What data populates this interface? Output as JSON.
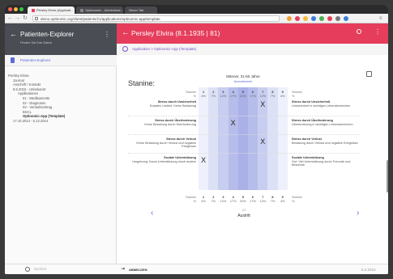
{
  "browser": {
    "tabs": [
      {
        "label": "Persley Elvira (Applicati..."
      },
      {
        "label": "Optionomic - Administrat..."
      },
      {
        "label": "Neuer Tab"
      }
    ],
    "url": "demo.optinomic.org/client/patients/21/applications/optinomic-app/template",
    "colors": {
      "brand": "#e53d5b"
    }
  },
  "sidebar": {
    "title": "Patienten-Explorer",
    "subtitle": "Finden Sie Ihre Daten",
    "section_label": "Patienten-Explorer",
    "tree": [
      {
        "label": "Persley Elvira",
        "level": 0,
        "bold": false
      },
      {
        "label": "Journal",
        "level": 1,
        "bold": false
      },
      {
        "label": "Anschrift / Kontakt",
        "level": 1,
        "bold": false
      },
      {
        "label": "9.6.2015 - Unbekannt",
        "level": 1,
        "bold": false
      },
      {
        "label": "Applikationen",
        "level": 2,
        "bold": false
      },
      {
        "label": "01 - Medikamente",
        "level": 3,
        "bold": false
      },
      {
        "label": "02 - Diagnosen",
        "level": 3,
        "bold": false
      },
      {
        "label": "03 - Verlaufseintrag",
        "level": 3,
        "bold": false
      },
      {
        "label": "BSCL",
        "level": 3,
        "bold": false
      },
      {
        "label": "Optinomic-App (Template)",
        "level": 3,
        "bold": true
      },
      {
        "label": "17.10.2014 - 5.12.2014",
        "level": 1,
        "bold": false
      }
    ],
    "search_placeholder": "Suchen"
  },
  "header": {
    "patient": "Persley Elvira (8.1.1935 | 81)",
    "app_name": "Optinomic-App (Template)",
    "breadcrumb": "Application > Optinomic-App (Template)"
  },
  "content": {
    "title": "Stanine:",
    "chart_title": "Männer, 31-50 Jahre",
    "chart_subtitle": "Normalbereich",
    "stanine_label": "Stanine",
    "percent_label": "%",
    "stanines": [
      "1",
      "2",
      "3",
      "4",
      "5",
      "6",
      "7",
      "8",
      "9"
    ],
    "percents": [
      "4%",
      "7%",
      "12%",
      "17%",
      "20%",
      "17%",
      "12%",
      "7%",
      "4%"
    ],
    "rows": [
      {
        "left_title": "Stress durch Unsicherheit",
        "left_desc": "Soziales Umfeld. Keine Belastung",
        "right_title": "Stress durch Unsicherheit",
        "right_desc": "Unsicherheit in wichtigen Lebensbereichen",
        "mark": 7
      },
      {
        "left_title": "Stress durch Überforderung",
        "left_desc": "Keine Belastung durch Überforderung",
        "right_title": "Stress durch Überforderung",
        "right_desc": "Überforderung in wichtigen Lebensbereichen",
        "mark": 4
      },
      {
        "left_title": "Stress durch Verlust",
        "left_desc": "Keine Belastung durch Verlust und negative Ereignisse",
        "right_title": "Stress durch Verlust",
        "right_desc": "Belastung durch Verlust und negative Ereignisse",
        "mark": 7
      },
      {
        "left_title": "Soziale Unterstützung",
        "left_desc": "Umgebung: Kaum Unterstützung durch andere",
        "right_title": "Soziale Unterstützung",
        "right_desc": "Gut: Viel Unterstützung durch Freunde und Bekannte",
        "mark": 1
      }
    ],
    "mark_symbol": "X",
    "pager": "1/2",
    "pager_label": "Austritt"
  },
  "footer": {
    "logout": "ABMELDEN",
    "date": "8.2.2016"
  }
}
